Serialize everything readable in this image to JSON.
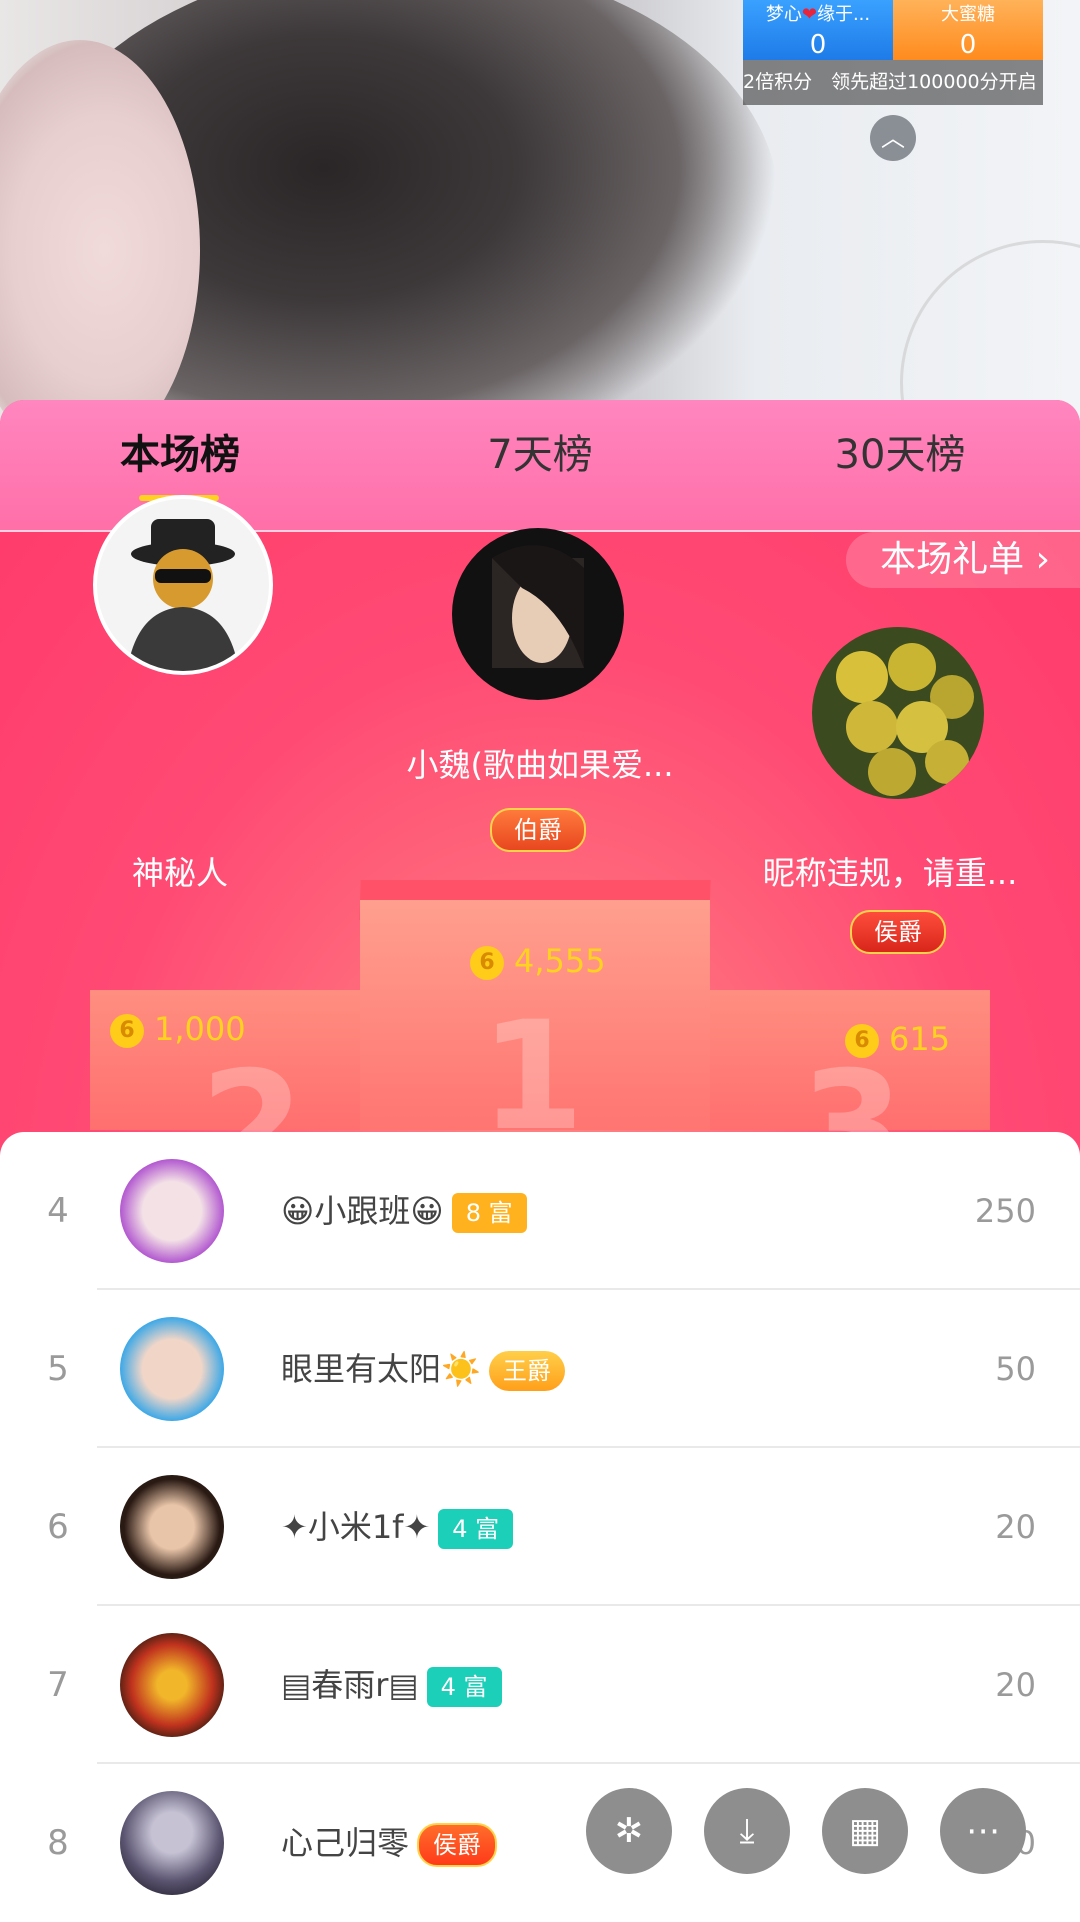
{
  "pk": {
    "left_name": "梦心",
    "left_name_suffix": "缘于...",
    "left_score": "0",
    "right_name": "大蜜糖",
    "right_score": "0",
    "banner": "2倍积分　领先超过100000分开启",
    "collapse_icon": "chevron-up-icon"
  },
  "tabs": [
    {
      "label": "本场榜",
      "active": true
    },
    {
      "label": "7天榜",
      "active": false
    },
    {
      "label": "30天榜",
      "active": false
    }
  ],
  "gift_link": "本场礼单",
  "top3": {
    "first": {
      "name": "小魏(歌曲如果爱...",
      "badge": "伯爵",
      "coins": "4,555",
      "rank": "1"
    },
    "second": {
      "name": "神秘人",
      "coins": "1,000",
      "rank": "2"
    },
    "third": {
      "name": "昵称违规，请重...",
      "badge": "侯爵",
      "coins": "615",
      "rank": "3"
    }
  },
  "coin_symbol": "6",
  "list": [
    {
      "rank": "4",
      "name": "😀小跟班😀",
      "tag": "8 富",
      "tag_type": "rich8",
      "score": "250"
    },
    {
      "rank": "5",
      "name": "眼里有太阳☀️",
      "tag": "王爵",
      "tag_type": "wang",
      "score": "50"
    },
    {
      "rank": "6",
      "name": "✦小米1f✦",
      "tag": "4 富",
      "tag_type": "rich4",
      "score": "20"
    },
    {
      "rank": "7",
      "name": "▤春雨r▤",
      "tag": "4 富",
      "tag_type": "rich4",
      "score": "20"
    },
    {
      "rank": "8",
      "name": "心己归零",
      "tag": "侯爵",
      "tag_type": "hou",
      "score": "20"
    }
  ],
  "fabs": [
    "share-icon",
    "download-icon",
    "grid-icon",
    "more-icon"
  ],
  "colors": {
    "accent_pink": "#ff4d82",
    "tab_gold": "#ffd21f",
    "coin_yellow": "#ffd21f"
  }
}
